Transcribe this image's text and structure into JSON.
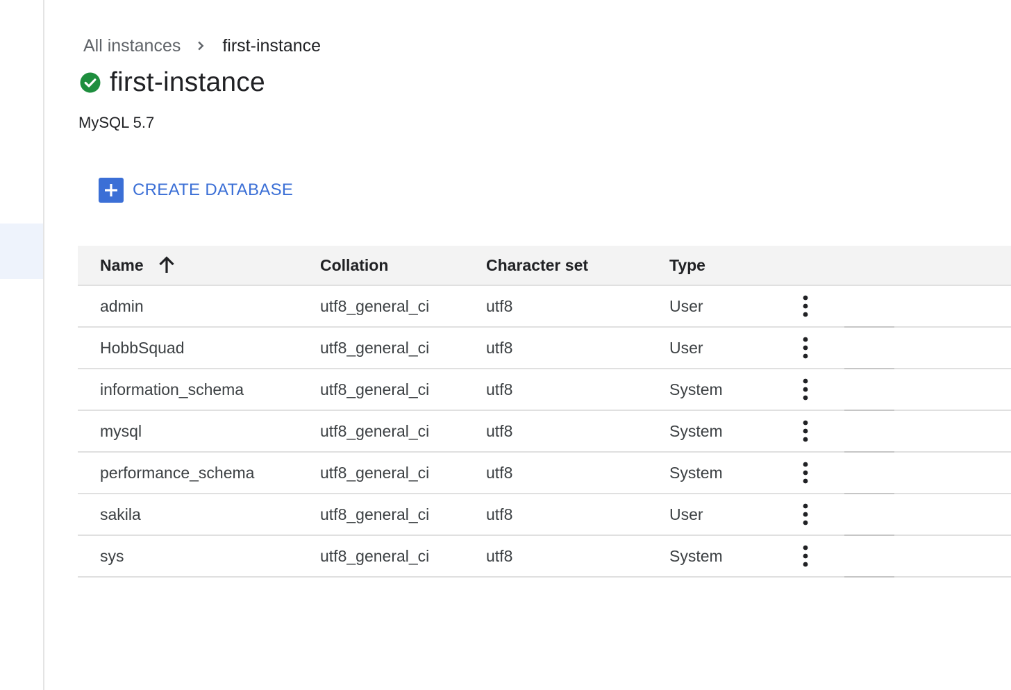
{
  "breadcrumb": {
    "parent": "All instances",
    "current": "first-instance"
  },
  "instance": {
    "name": "first-instance",
    "status": "running",
    "version": "MySQL 5.7"
  },
  "actions": {
    "create_database": "CREATE DATABASE"
  },
  "table": {
    "columns": {
      "name": "Name",
      "collation": "Collation",
      "character_set": "Character set",
      "type": "Type"
    },
    "sort": {
      "column": "Name",
      "direction": "ascending"
    },
    "rows": [
      {
        "name": "admin",
        "collation": "utf8_general_ci",
        "charset": "utf8",
        "type": "User"
      },
      {
        "name": "HobbSquad",
        "collation": "utf8_general_ci",
        "charset": "utf8",
        "type": "User"
      },
      {
        "name": "information_schema",
        "collation": "utf8_general_ci",
        "charset": "utf8",
        "type": "System"
      },
      {
        "name": "mysql",
        "collation": "utf8_general_ci",
        "charset": "utf8",
        "type": "System"
      },
      {
        "name": "performance_schema",
        "collation": "utf8_general_ci",
        "charset": "utf8",
        "type": "System"
      },
      {
        "name": "sakila",
        "collation": "utf8_general_ci",
        "charset": "utf8",
        "type": "User"
      },
      {
        "name": "sys",
        "collation": "utf8_general_ci",
        "charset": "utf8",
        "type": "System"
      }
    ]
  },
  "icons": {
    "status": "check-circle-icon",
    "breadcrumb_separator": "chevron-right-icon",
    "create": "add-box-icon",
    "sort": "arrow-upward-icon",
    "row_menu": "more-vert-icon"
  },
  "colors": {
    "accent": "#3b6fd6",
    "status_ok": "#1e8e3e",
    "header_bg": "#f3f3f3"
  }
}
